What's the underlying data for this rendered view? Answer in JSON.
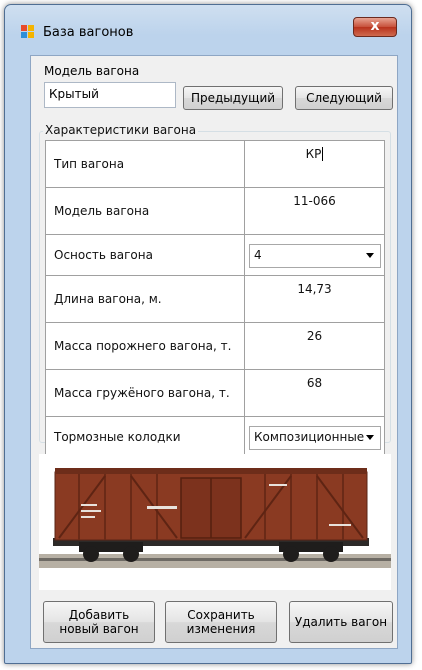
{
  "window": {
    "title": "База вагонов",
    "close_glyph": "x"
  },
  "model": {
    "label": "Модель вагона",
    "value": "Крытый",
    "prev_label": "Предыдущий",
    "next_label": "Следующий"
  },
  "characteristics": {
    "title": "Характеристики вагона",
    "rows": [
      {
        "label": "Тип вагона",
        "value": "КР"
      },
      {
        "label": "Модель вагона",
        "value": "11-066"
      },
      {
        "label": "Осность вагона",
        "value": "4"
      },
      {
        "label": "Длина вагона, м.",
        "value": "14,73"
      },
      {
        "label": "Масса порожнего вагона, т.",
        "value": "26"
      },
      {
        "label": "Масса гружёного вагона, т.",
        "value": "68"
      },
      {
        "label": "Тормозные колодки",
        "value": "Композиционные"
      }
    ]
  },
  "buttons": {
    "add": "Добавить\nновый вагон",
    "save": "Сохранить\nизменения",
    "delete": "Удалить вагон"
  },
  "colors": {
    "wagon_body": "#8a3a22",
    "titlebar": "#bcd3ec",
    "close": "#c7503a"
  }
}
